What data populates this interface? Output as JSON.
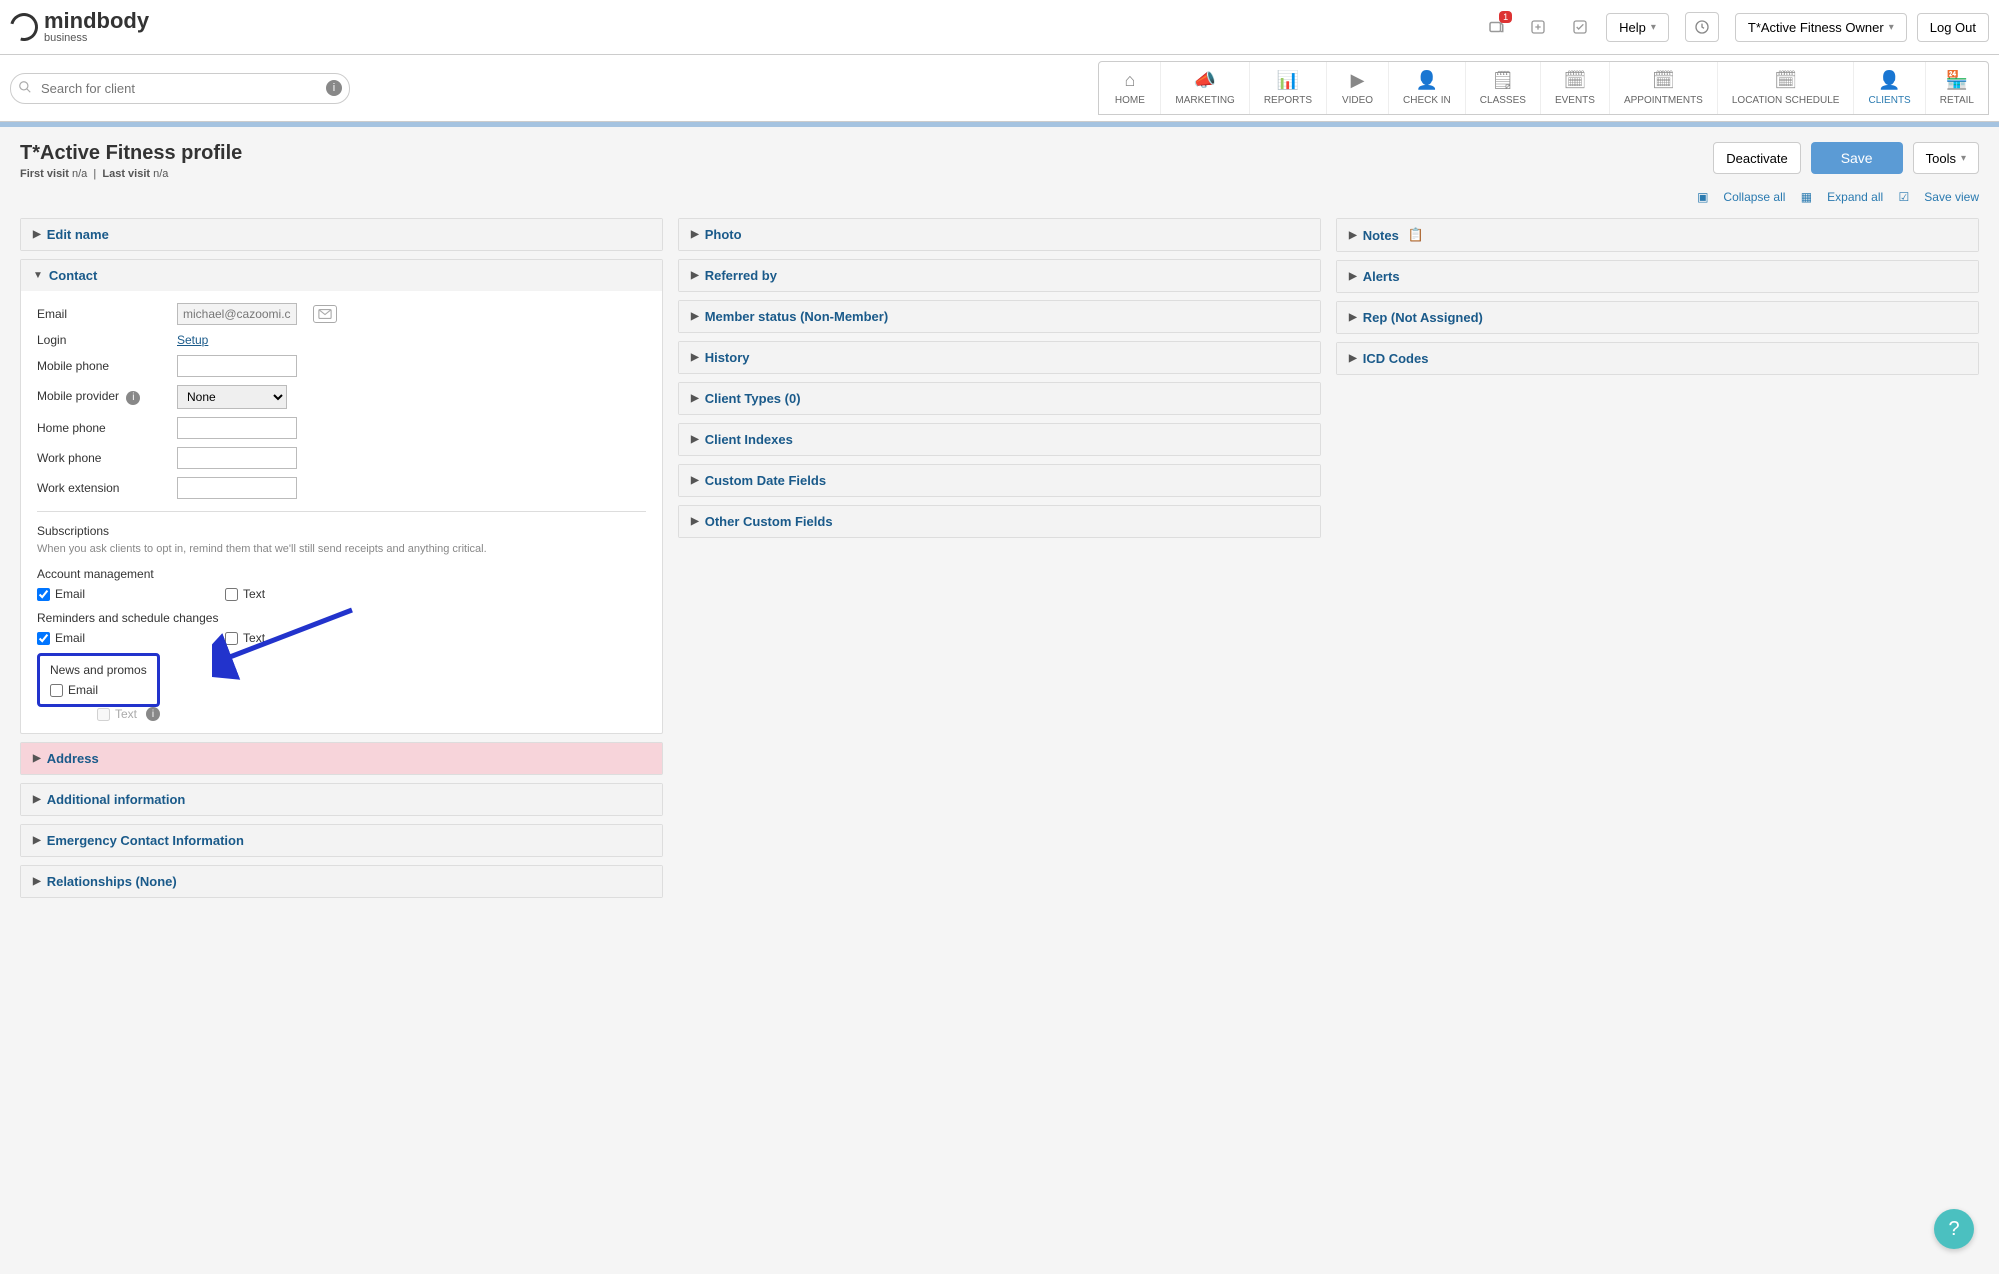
{
  "app": {
    "logo_main": "mindbody",
    "logo_sub": "business"
  },
  "topbar": {
    "badge": "1",
    "help": "Help",
    "user": "T*Active Fitness Owner",
    "logout": "Log Out"
  },
  "search": {
    "placeholder": "Search for client"
  },
  "mainnav": [
    {
      "key": "home",
      "label": "HOME",
      "icon": "⌂"
    },
    {
      "key": "marketing",
      "label": "MARKETING",
      "icon": "📣"
    },
    {
      "key": "reports",
      "label": "REPORTS",
      "icon": "📊"
    },
    {
      "key": "video",
      "label": "VIDEO",
      "icon": "▶"
    },
    {
      "key": "checkin",
      "label": "CHECK IN",
      "icon": "👤"
    },
    {
      "key": "classes",
      "label": "CLASSES",
      "icon": "🗒"
    },
    {
      "key": "events",
      "label": "EVENTS",
      "icon": "🗓"
    },
    {
      "key": "appointments",
      "label": "APPOINTMENTS",
      "icon": "🗓"
    },
    {
      "key": "locschedule",
      "label": "LOCATION SCHEDULE",
      "icon": "🗓"
    },
    {
      "key": "clients",
      "label": "CLIENTS",
      "icon": "👤",
      "active": true
    },
    {
      "key": "retail",
      "label": "RETAIL",
      "icon": "🏪"
    }
  ],
  "page": {
    "title": "T*Active Fitness profile",
    "first_visit_label": "First visit",
    "first_visit_val": "n/a",
    "last_visit_label": "Last visit",
    "last_visit_val": "n/a",
    "deactivate": "Deactivate",
    "save": "Save",
    "tools": "Tools",
    "collapse": "Collapse all",
    "expand": "Expand all",
    "saveview": "Save view"
  },
  "col1": {
    "editname": "Edit name",
    "contact": {
      "title": "Contact",
      "email_label": "Email",
      "email_val": "michael@cazoomi.com",
      "login_label": "Login",
      "login_setup": "Setup",
      "mobile_label": "Mobile phone",
      "provider_label": "Mobile provider",
      "provider_val": "None",
      "home_label": "Home phone",
      "work_label": "Work phone",
      "ext_label": "Work extension",
      "subs_hdr": "Subscriptions",
      "subs_desc": "When you ask clients to opt in, remind them that we'll still send receipts and anything critical.",
      "acct_mgmt": "Account management",
      "reminders": "Reminders and schedule changes",
      "news": "News and promos",
      "cb_email": "Email",
      "cb_text": "Text"
    },
    "address": "Address",
    "additional": "Additional information",
    "emergency": "Emergency Contact Information",
    "relationships": "Relationships (None)"
  },
  "col2": {
    "photo": "Photo",
    "referred": "Referred by",
    "member": "Member status (Non-Member)",
    "history": "History",
    "ctypes": "Client Types (0)",
    "cindexes": "Client Indexes",
    "cdates": "Custom Date Fields",
    "cother": "Other Custom Fields"
  },
  "col3": {
    "notes": "Notes",
    "alerts": "Alerts",
    "rep": "Rep (Not Assigned)",
    "icd": "ICD Codes"
  }
}
